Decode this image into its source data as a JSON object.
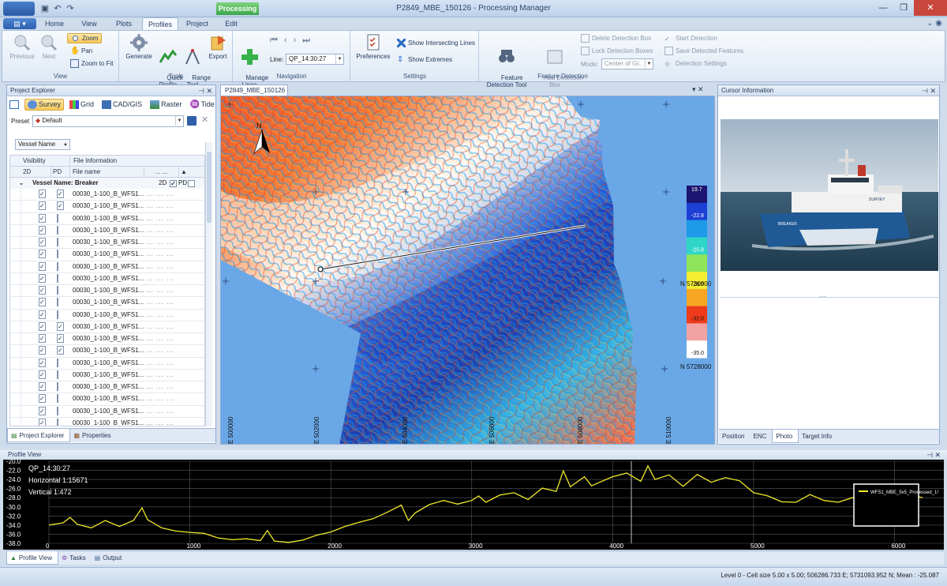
{
  "window": {
    "title": "P2849_MBE_150126 - Processing Manager",
    "context_tab": "Processing",
    "controls": [
      "—",
      "❐",
      "✕"
    ]
  },
  "ribbon_tabs": [
    "Home",
    "View",
    "Plots",
    "Profiles",
    "Project",
    "Edit"
  ],
  "ribbon_active_tab": "Profiles",
  "ribbon": {
    "view": {
      "label": "View",
      "previous": "Previous",
      "next": "Next",
      "zoom": "Zoom",
      "pan": "Pan",
      "zoom_to_fit": "Zoom to Fit"
    },
    "tools": {
      "label": "Tools",
      "generate": "Generate",
      "quick_profile": "Quick\nProfile",
      "range_tool": "Range\nTool",
      "export": "Export"
    },
    "navigation": {
      "label": "Navigation",
      "manage_lines": "Manage\nLines",
      "line_label": "Line:",
      "line_value": "QP_14:30:27"
    },
    "settings": {
      "label": "Settings",
      "preferences": "Preferences",
      "show_intersecting_lines": "Show Intersecting Lines",
      "show_extremes": "Show Extremes"
    },
    "feature_detection": {
      "label": "Feature Detection",
      "feature_detection_tool": "Feature\nDetection Tool",
      "add_detection_box": "Add Detection\nBox",
      "delete_detection_box": "Delete Detection Box",
      "lock_detection_boxes": "Lock Detection Boxes",
      "mode_label": "Mode:",
      "mode_value": "Center of Gr...",
      "start_detection": "Start Detection",
      "save_detected_features": "Save Detected Features",
      "detection_settings": "Detection Settings"
    }
  },
  "project_explorer": {
    "title": "Project Explorer",
    "toolbar": [
      "Survey",
      "Grid",
      "CAD/GIS",
      "Raster",
      "Tide"
    ],
    "preset_label": "Preset",
    "preset_value": "Default",
    "group_by": "Vessel Name",
    "col_visibility": "Visibility",
    "col_file_info": "File Information",
    "col_2d": "2D",
    "col_pd": "PD",
    "col_file_name": "File name",
    "group_header": "Vessel Name: Breaker",
    "group_2d": "2D",
    "group_pd": "PD",
    "rows": [
      {
        "name": "00030_1-100_B_WFS1...",
        "v2d": true,
        "pd": true
      },
      {
        "name": "00030_1-100_B_WFS1...",
        "v2d": true,
        "pd": true
      },
      {
        "name": "00030_1-100_B_WFS1...",
        "v2d": true,
        "pd": false
      },
      {
        "name": "00030_1-100_B_WFS1...",
        "v2d": true,
        "pd": false
      },
      {
        "name": "00030_1-100_B_WFS1...",
        "v2d": true,
        "pd": false
      },
      {
        "name": "00030_1-100_B_WFS1...",
        "v2d": true,
        "pd": false
      },
      {
        "name": "00030_1-100_B_WFS1...",
        "v2d": true,
        "pd": false
      },
      {
        "name": "00030_1-100_B_WFS1...",
        "v2d": true,
        "pd": false
      },
      {
        "name": "00030_1-100_B_WFS1...",
        "v2d": true,
        "pd": false
      },
      {
        "name": "00030_1-100_B_WFS1...",
        "v2d": true,
        "pd": false
      },
      {
        "name": "00030_1-100_B_WFS1...",
        "v2d": true,
        "pd": false
      },
      {
        "name": "00030_1-100_B_WFS1...",
        "v2d": true,
        "pd": true
      },
      {
        "name": "00030_1-100_B_WFS1...",
        "v2d": true,
        "pd": true
      },
      {
        "name": "00030_1-100_B_WFS1...",
        "v2d": true,
        "pd": true
      },
      {
        "name": "00030_1-100_B_WFS1...",
        "v2d": true,
        "pd": false
      },
      {
        "name": "00030_1-100_B_WFS1...",
        "v2d": true,
        "pd": false
      },
      {
        "name": "00030_1-100_B_WFS1...",
        "v2d": true,
        "pd": false
      },
      {
        "name": "00030_1-100_B_WFS1...",
        "v2d": true,
        "pd": false
      },
      {
        "name": "00030_1-100_B_WFS1...",
        "v2d": true,
        "pd": false
      },
      {
        "name": "00030_1-100_B_WFS1...",
        "v2d": true,
        "pd": false
      }
    ],
    "bottom_tabs": [
      "Project Explorer",
      "Properties"
    ]
  },
  "map": {
    "tab_title": "P2849_MBE_150126",
    "north_label": "N",
    "northings": [
      "N 5730000",
      "N 5728000"
    ],
    "eastings": [
      "E 500000",
      "E 502000",
      "E 504000",
      "E 506000",
      "E 508000",
      "E 510000"
    ],
    "colorbar": {
      "max": "19.7",
      "ticks": [
        "-22.8",
        "-25.8",
        "-28.9",
        "-32.0",
        "-35.0"
      ],
      "colors": [
        "#1c1470",
        "#1e3fd6",
        "#1d9be8",
        "#2fd6c8",
        "#8ee55a",
        "#f3ee32",
        "#f6a623",
        "#ee3b1c",
        "#f2a2a2",
        "#ffffff"
      ]
    }
  },
  "cursor_info": {
    "title": "Cursor Information",
    "photo_caption_boat": "BREAKER",
    "photo_caption_survey": "SURVEY",
    "bottom_tabs": [
      "Position",
      "ENC",
      "Photo",
      "Target Info"
    ],
    "active_tab": "Photo"
  },
  "profile_view": {
    "title": "Profile View",
    "line_name": "QP_14:30:27",
    "horizontal": "Horizontal 1:15671",
    "vertical": "Vertical 1:472",
    "legend": "WFS1_MBE_5x5_Processed_1!",
    "bottom_tabs": [
      "Profile View",
      "Tasks",
      "Output"
    ]
  },
  "chart_data": {
    "type": "line",
    "title": "",
    "xlabel": "",
    "ylabel": "",
    "xlim": [
      0,
      6350
    ],
    "ylim": [
      -38.0,
      -20.0
    ],
    "y_ticks": [
      "-20.0",
      "-22.0",
      "-24.0",
      "-26.0",
      "-28.0",
      "-30.0",
      "-32.0",
      "-34.0",
      "-36.0",
      "-38.0"
    ],
    "x_ticks": [
      "0",
      "1000",
      "2000",
      "3000",
      "4000",
      "5000",
      "6000"
    ],
    "series": [
      {
        "name": "WFS1_MBE_5x5_Processed_1!",
        "color": "#f2ea2a",
        "x": [
          0,
          100,
          150,
          200,
          300,
          400,
          500,
          600,
          660,
          700,
          800,
          900,
          1000,
          1100,
          1200,
          1300,
          1400,
          1500,
          1550,
          1600,
          1700,
          1800,
          1900,
          2000,
          2100,
          2200,
          2300,
          2400,
          2500,
          2550,
          2600,
          2700,
          2800,
          2900,
          3000,
          3050,
          3100,
          3200,
          3300,
          3400,
          3500,
          3600,
          3650,
          3700,
          3800,
          3850,
          3900,
          4000,
          4100,
          4200,
          4250,
          4300,
          4400,
          4500,
          4600,
          4700,
          4800,
          4900,
          5000,
          5100,
          5200,
          5300,
          5400,
          5500,
          5600,
          5700,
          5800,
          5900,
          6000,
          6100,
          6200
        ],
        "y": [
          -34.0,
          -33.5,
          -32.3,
          -33.8,
          -34.6,
          -33.0,
          -34.3,
          -33.0,
          -30.2,
          -32.8,
          -34.6,
          -35.3,
          -35.6,
          -35.8,
          -36.8,
          -37.2,
          -37.0,
          -37.4,
          -35.2,
          -37.5,
          -37.8,
          -37.3,
          -36.2,
          -35.5,
          -34.3,
          -33.4,
          -32.6,
          -31.2,
          -29.6,
          -33.0,
          -31.3,
          -29.5,
          -28.6,
          -29.4,
          -28.6,
          -27.6,
          -29.0,
          -27.4,
          -26.9,
          -28.4,
          -25.9,
          -26.6,
          -22.1,
          -25.6,
          -23.4,
          -25.4,
          -24.7,
          -23.4,
          -22.6,
          -24.4,
          -21.0,
          -24.0,
          -23.0,
          -25.5,
          -22.9,
          -24.6,
          -23.6,
          -24.3,
          -26.9,
          -27.6,
          -28.9,
          -29.0,
          -27.3,
          -28.6,
          -29.0,
          -28.0,
          -28.3,
          -29.1,
          -28.0,
          -27.3,
          -28.0
        ]
      }
    ]
  },
  "status": {
    "text": "Level 0 - Cell size 5.00 x 5.00; 506286.733 E; 5731093.952 N; Mean : -25.087"
  }
}
